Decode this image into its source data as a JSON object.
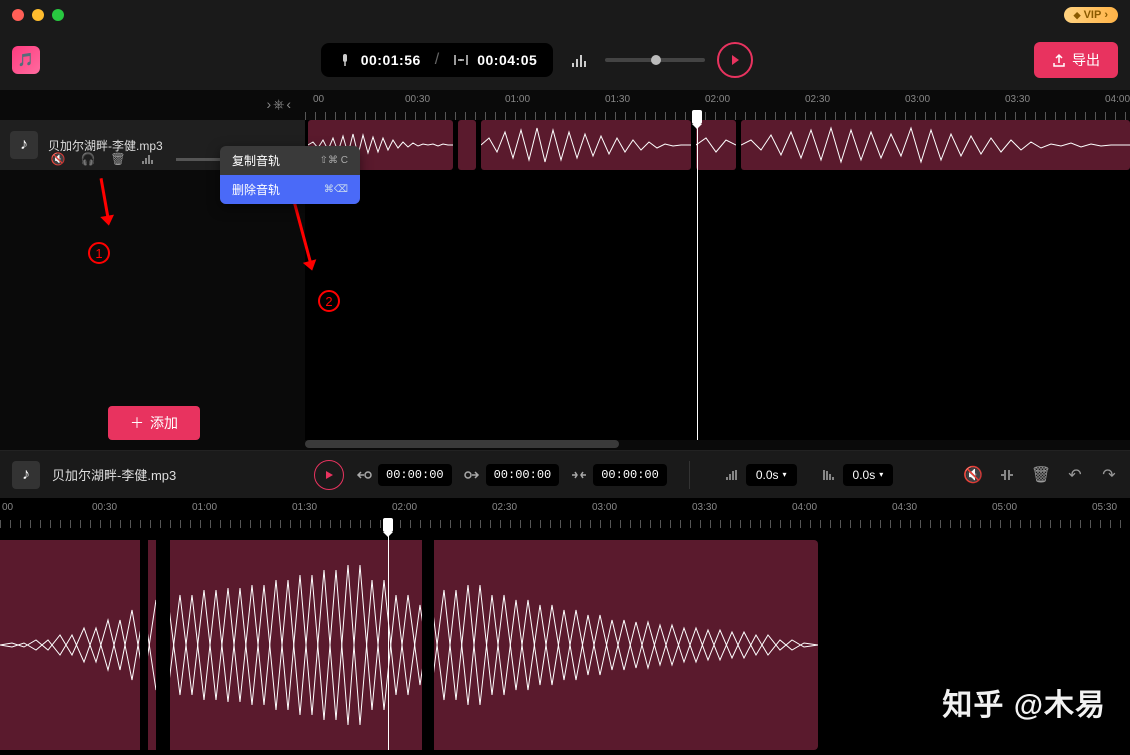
{
  "titlebar": {
    "vip_label": "VIP"
  },
  "toolbar": {
    "current_time": "00:01:56",
    "total_time": "00:04:05",
    "export_label": "导出"
  },
  "upper": {
    "ruler_ticks": [
      "00",
      "00:30",
      "01:00",
      "01:30",
      "02:00",
      "02:30",
      "03:00",
      "03:30",
      "04:00"
    ],
    "track_name": "贝加尔湖畔-李健.mp3",
    "add_label": "添加",
    "context_menu": {
      "copy_label": "复制音轨",
      "copy_shortcut": "⇧⌘ C",
      "delete_label": "删除音轨",
      "delete_shortcut": "⌘⌫"
    },
    "annotation_1": "1",
    "annotation_2": "2"
  },
  "detail": {
    "track_name": "贝加尔湖畔-李健.mp3",
    "trim_start": "00:00:00",
    "trim_end": "00:00:00",
    "trim_offset": "00:00:00",
    "fade_in": "0.0s",
    "fade_out": "0.0s"
  },
  "lower": {
    "ruler_ticks": [
      "00",
      "00:30",
      "01:00",
      "01:30",
      "02:00",
      "02:30",
      "03:00",
      "03:30",
      "04:00",
      "04:30",
      "05:00",
      "05:30"
    ]
  },
  "watermark": "知乎 @木易"
}
